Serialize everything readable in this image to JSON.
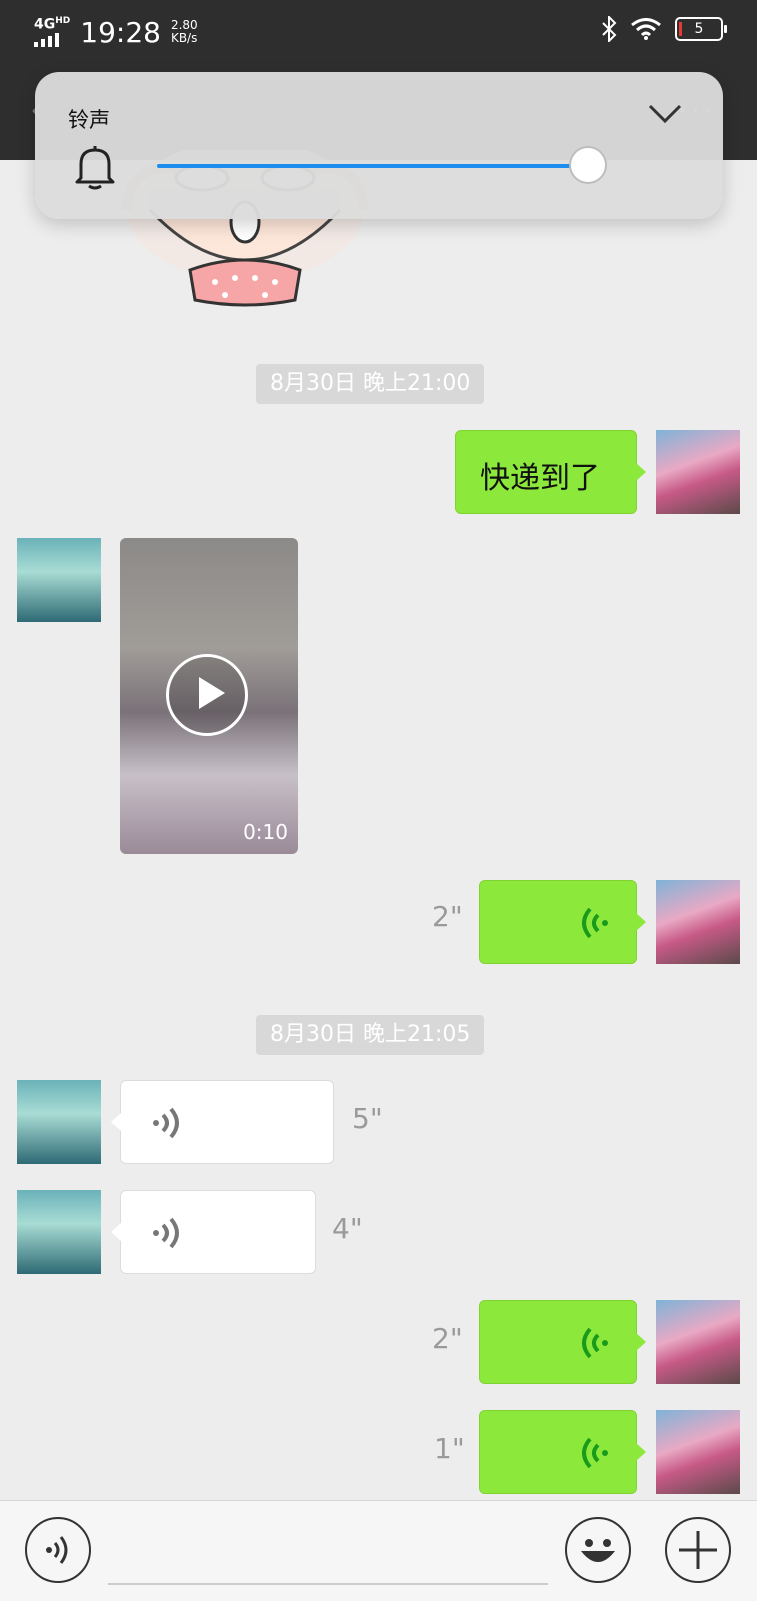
{
  "status_bar": {
    "network": "4G",
    "network_sup": "HD",
    "time": "19:28",
    "speed_value": "2.80",
    "speed_unit": "KB/s",
    "battery": "5"
  },
  "volume_panel": {
    "title": "铃声",
    "level": 0.98
  },
  "timestamps": [
    "8月30日 晚上21:00",
    "8月30日 晚上21:05"
  ],
  "messages": {
    "text_1": "快递到了",
    "video_duration": "0:10",
    "voice_out_1": "2\"",
    "voice_in_1": "5\"",
    "voice_in_2": "4\"",
    "voice_out_2": "2\"",
    "voice_out_3": "1\""
  },
  "colors": {
    "bubble_out": "#8ce93b",
    "slider_fill": "#1e8df0",
    "voice_wave_out": "#1a9a1a"
  }
}
